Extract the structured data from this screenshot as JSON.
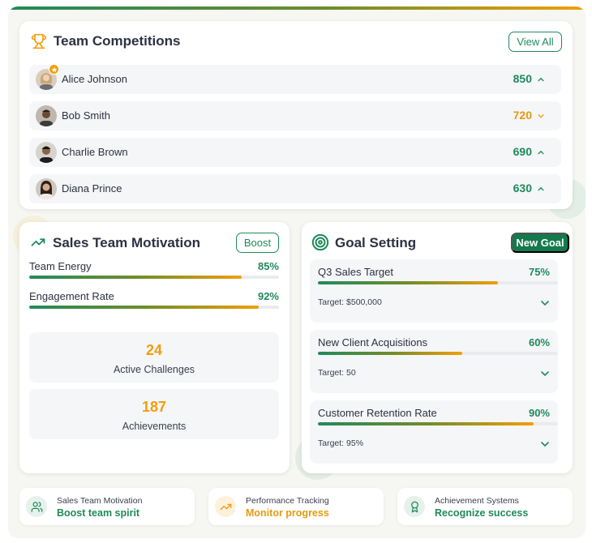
{
  "competitions": {
    "title": "Team Competitions",
    "view_all_label": "View All",
    "rows": [
      {
        "name": "Alice Johnson",
        "score": "850",
        "trend": "up",
        "leader": true
      },
      {
        "name": "Bob Smith",
        "score": "720",
        "trend": "down",
        "leader": false
      },
      {
        "name": "Charlie Brown",
        "score": "690",
        "trend": "up",
        "leader": false
      },
      {
        "name": "Diana Prince",
        "score": "630",
        "trend": "up",
        "leader": false
      }
    ]
  },
  "motivation": {
    "title": "Sales Team Motivation",
    "boost_label": "Boost",
    "metrics": [
      {
        "label": "Team Energy",
        "value": "85%",
        "fraction": 0.85
      },
      {
        "label": "Engagement Rate",
        "value": "92%",
        "fraction": 0.92
      }
    ],
    "stats": [
      {
        "number": "24",
        "label": "Active Challenges"
      },
      {
        "number": "187",
        "label": "Achievements"
      }
    ]
  },
  "goals": {
    "title": "Goal Setting",
    "new_goal_label": "New Goal",
    "items": [
      {
        "name": "Q3 Sales Target",
        "percent": "75%",
        "fraction": 0.75,
        "target": "Target: $500,000"
      },
      {
        "name": "New Client Acquisitions",
        "percent": "60%",
        "fraction": 0.6,
        "target": "Target: 50"
      },
      {
        "name": "Customer Retention Rate",
        "percent": "90%",
        "fraction": 0.9,
        "target": "Target: 95%"
      }
    ]
  },
  "footer": [
    {
      "title": "Sales Team Motivation",
      "subtitle": "Boost team spirit",
      "icon": "users-icon"
    },
    {
      "title": "Performance Tracking",
      "subtitle": "Monitor progress",
      "icon": "trending-up-icon"
    },
    {
      "title": "Achievement Systems",
      "subtitle": "Recognize success",
      "icon": "award-icon"
    }
  ],
  "colors": {
    "primary": "#1f8a5b",
    "accent": "#f29e0c",
    "primary_dark": "#137a4d"
  }
}
